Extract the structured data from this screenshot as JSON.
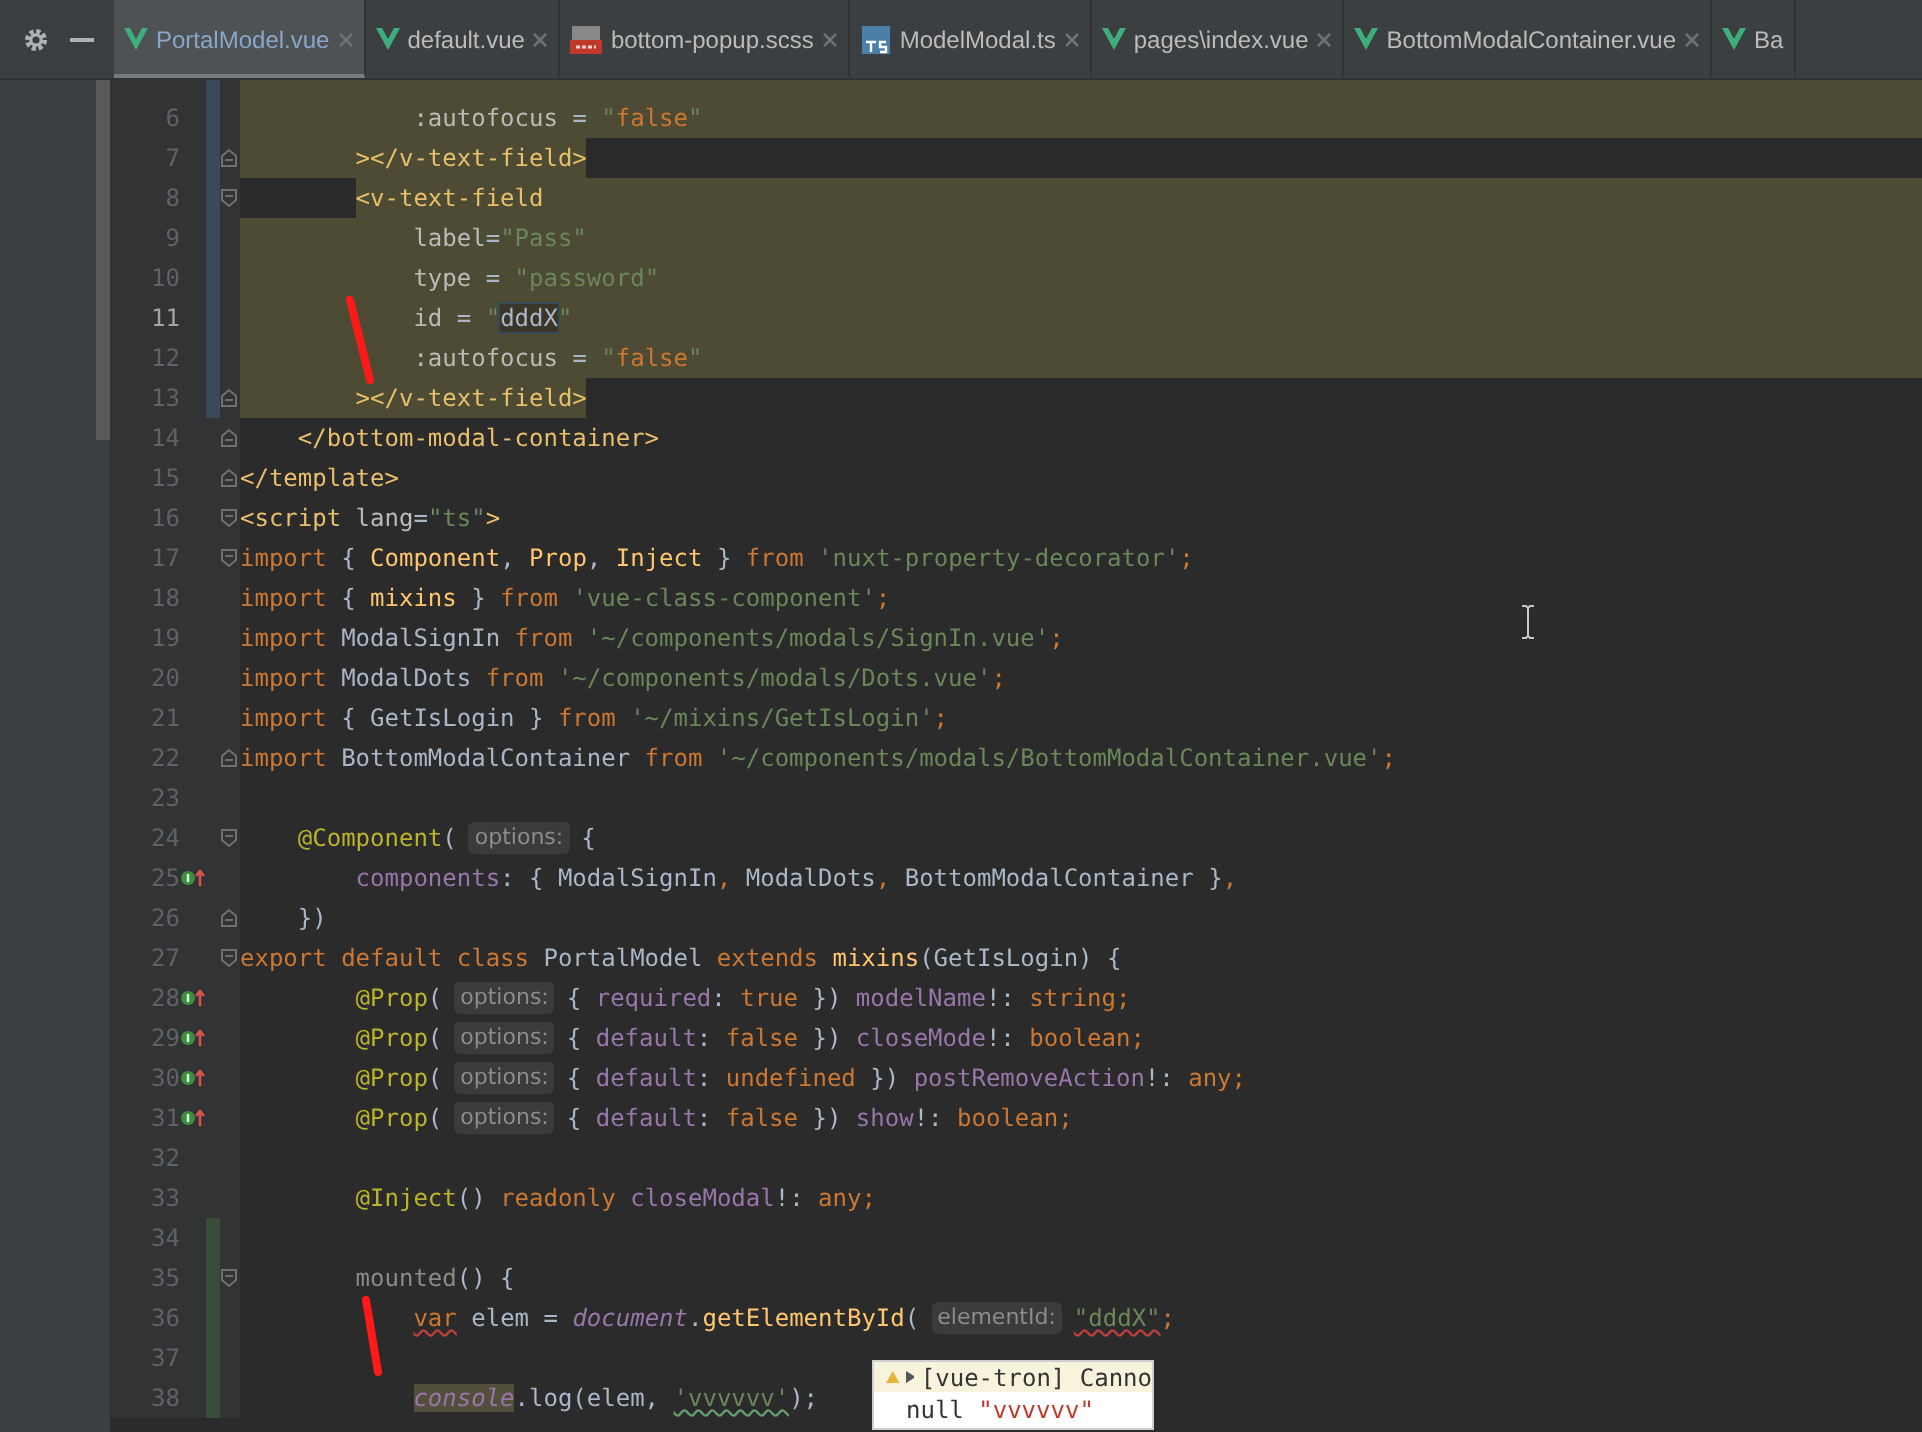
{
  "tabs": [
    {
      "label": "PortalModel.vue",
      "kind": "vue",
      "selected": true
    },
    {
      "label": "default.vue",
      "kind": "vue",
      "selected": false
    },
    {
      "label": "bottom-popup.scss",
      "kind": "sass",
      "selected": false
    },
    {
      "label": "ModelModal.ts",
      "kind": "ts",
      "selected": false
    },
    {
      "label": "pages\\index.vue",
      "kind": "vue",
      "selected": false
    },
    {
      "label": "BottomModalContainer.vue",
      "kind": "vue",
      "selected": false
    },
    {
      "label": "Ba",
      "kind": "vue",
      "selected": false
    }
  ],
  "lines": [
    {
      "number": "6",
      "current": false,
      "highlighted": true,
      "highlight_ends_at_text": false,
      "highlight_starts_at_text": false,
      "gutter_selected": true,
      "added": false,
      "fold_start": false,
      "fold_end": false,
      "overrides": false,
      "tokens": [
        {
          "kind": "attr",
          "text": "            :autofocus"
        },
        {
          "kind": "plain",
          "text": " = "
        },
        {
          "kind": "str",
          "text": "\""
        },
        {
          "kind": "kw",
          "text": "false"
        },
        {
          "kind": "str",
          "text": "\""
        }
      ]
    },
    {
      "number": "7",
      "current": false,
      "highlighted": true,
      "highlight_ends_at_text": true,
      "highlight_starts_at_text": false,
      "gutter_selected": true,
      "added": false,
      "fold_start": false,
      "fold_end": true,
      "overrides": false,
      "tokens": [
        {
          "kind": "tag",
          "text": "        ></v-text-field>"
        }
      ]
    },
    {
      "number": "8",
      "current": false,
      "highlighted": true,
      "highlight_ends_at_text": false,
      "highlight_starts_at_text": true,
      "gutter_selected": true,
      "added": false,
      "fold_start": true,
      "fold_end": false,
      "overrides": false,
      "tokens": [
        {
          "kind": "tag",
          "text": "        <v-text-field"
        }
      ]
    },
    {
      "number": "9",
      "current": false,
      "highlighted": true,
      "highlight_ends_at_text": false,
      "highlight_starts_at_text": false,
      "gutter_selected": true,
      "added": false,
      "fold_start": false,
      "fold_end": false,
      "overrides": false,
      "tokens": [
        {
          "kind": "attr",
          "text": "            label"
        },
        {
          "kind": "plain",
          "text": "="
        },
        {
          "kind": "str",
          "text": "\"Pass\""
        }
      ]
    },
    {
      "number": "10",
      "current": false,
      "highlighted": true,
      "highlight_ends_at_text": false,
      "highlight_starts_at_text": false,
      "gutter_selected": true,
      "added": false,
      "fold_start": false,
      "fold_end": false,
      "overrides": false,
      "tokens": [
        {
          "kind": "attr",
          "text": "            type"
        },
        {
          "kind": "plain",
          "text": " = "
        },
        {
          "kind": "str",
          "text": "\"password\""
        }
      ]
    },
    {
      "number": "11",
      "current": true,
      "highlighted": true,
      "highlight_ends_at_text": false,
      "highlight_starts_at_text": false,
      "gutter_selected": true,
      "added": false,
      "fold_start": false,
      "fold_end": false,
      "overrides": false,
      "tokens": [
        {
          "kind": "attr",
          "text": "            id"
        },
        {
          "kind": "plain",
          "text": " = "
        },
        {
          "kind": "str",
          "text": "\""
        },
        {
          "kind": "match",
          "text": "dddX"
        },
        {
          "kind": "str",
          "text": "\""
        }
      ]
    },
    {
      "number": "12",
      "current": false,
      "highlighted": true,
      "highlight_ends_at_text": false,
      "highlight_starts_at_text": false,
      "gutter_selected": true,
      "added": false,
      "fold_start": false,
      "fold_end": false,
      "overrides": false,
      "tokens": [
        {
          "kind": "attr",
          "text": "            :autofocus"
        },
        {
          "kind": "plain",
          "text": " = "
        },
        {
          "kind": "str",
          "text": "\""
        },
        {
          "kind": "kw",
          "text": "false"
        },
        {
          "kind": "str",
          "text": "\""
        }
      ]
    },
    {
      "number": "13",
      "current": false,
      "highlighted": true,
      "highlight_ends_at_text": true,
      "highlight_starts_at_text": false,
      "gutter_selected": true,
      "added": false,
      "fold_start": false,
      "fold_end": true,
      "overrides": false,
      "tokens": [
        {
          "kind": "tag",
          "text": "        ></v-text-field>"
        }
      ]
    },
    {
      "number": "14",
      "current": false,
      "highlighted": false,
      "gutter_selected": false,
      "added": false,
      "fold_start": false,
      "fold_end": true,
      "overrides": false,
      "tokens": [
        {
          "kind": "tag",
          "text": "    </bottom-modal-container>"
        }
      ]
    },
    {
      "number": "15",
      "current": false,
      "highlighted": false,
      "gutter_selected": false,
      "added": false,
      "fold_start": false,
      "fold_end": true,
      "overrides": false,
      "tokens": [
        {
          "kind": "tag",
          "text": "</template>"
        }
      ]
    },
    {
      "number": "16",
      "current": false,
      "highlighted": false,
      "gutter_selected": false,
      "added": false,
      "fold_start": true,
      "fold_end": false,
      "overrides": false,
      "tokens": [
        {
          "kind": "tag",
          "text": "<script "
        },
        {
          "kind": "attr",
          "text": "lang"
        },
        {
          "kind": "plain",
          "text": "="
        },
        {
          "kind": "str",
          "text": "\"ts\""
        },
        {
          "kind": "tag",
          "text": ">"
        }
      ]
    },
    {
      "number": "17",
      "current": false,
      "highlighted": false,
      "gutter_selected": false,
      "added": false,
      "fold_start": true,
      "fold_end": false,
      "overrides": false,
      "tokens": [
        {
          "kind": "kw",
          "text": "import "
        },
        {
          "kind": "plain",
          "text": "{ "
        },
        {
          "kind": "imp",
          "text": "Component"
        },
        {
          "kind": "plain",
          "text": ", "
        },
        {
          "kind": "imp",
          "text": "Prop"
        },
        {
          "kind": "plain",
          "text": ", "
        },
        {
          "kind": "imp",
          "text": "Inject"
        },
        {
          "kind": "plain",
          "text": " } "
        },
        {
          "kind": "kw",
          "text": "from "
        },
        {
          "kind": "str",
          "text": "'nuxt-property-decorator'"
        },
        {
          "kind": "kw",
          "text": ";"
        }
      ]
    },
    {
      "number": "18",
      "current": false,
      "highlighted": false,
      "gutter_selected": false,
      "added": false,
      "fold_start": false,
      "fold_end": false,
      "overrides": false,
      "tokens": [
        {
          "kind": "kw",
          "text": "import "
        },
        {
          "kind": "plain",
          "text": "{ "
        },
        {
          "kind": "imp",
          "text": "mixins"
        },
        {
          "kind": "plain",
          "text": " } "
        },
        {
          "kind": "kw",
          "text": "from "
        },
        {
          "kind": "str",
          "text": "'vue-class-component'"
        },
        {
          "kind": "kw",
          "text": ";"
        }
      ]
    },
    {
      "number": "19",
      "current": false,
      "highlighted": false,
      "gutter_selected": false,
      "added": false,
      "fold_start": false,
      "fold_end": false,
      "overrides": false,
      "tokens": [
        {
          "kind": "kw",
          "text": "import "
        },
        {
          "kind": "plain",
          "text": "ModalSignIn "
        },
        {
          "kind": "kw",
          "text": "from "
        },
        {
          "kind": "str",
          "text": "'~/components/modals/SignIn.vue'"
        },
        {
          "kind": "kw",
          "text": ";"
        }
      ]
    },
    {
      "number": "20",
      "current": false,
      "highlighted": false,
      "gutter_selected": false,
      "added": false,
      "fold_start": false,
      "fold_end": false,
      "overrides": false,
      "tokens": [
        {
          "kind": "kw",
          "text": "import "
        },
        {
          "kind": "plain",
          "text": "ModalDots "
        },
        {
          "kind": "kw",
          "text": "from "
        },
        {
          "kind": "str",
          "text": "'~/components/modals/Dots.vue'"
        },
        {
          "kind": "kw",
          "text": ";"
        }
      ]
    },
    {
      "number": "21",
      "current": false,
      "highlighted": false,
      "gutter_selected": false,
      "added": false,
      "fold_start": false,
      "fold_end": false,
      "overrides": false,
      "tokens": [
        {
          "kind": "kw",
          "text": "import "
        },
        {
          "kind": "plain",
          "text": "{ GetIsLogin } "
        },
        {
          "kind": "kw",
          "text": "from "
        },
        {
          "kind": "str",
          "text": "'~/mixins/GetIsLogin'"
        },
        {
          "kind": "kw",
          "text": ";"
        }
      ]
    },
    {
      "number": "22",
      "current": false,
      "highlighted": false,
      "gutter_selected": false,
      "added": false,
      "fold_start": false,
      "fold_end": true,
      "overrides": false,
      "tokens": [
        {
          "kind": "kw",
          "text": "import "
        },
        {
          "kind": "plain",
          "text": "BottomModalContainer "
        },
        {
          "kind": "kw",
          "text": "from "
        },
        {
          "kind": "str",
          "text": "'~/components/modals/BottomModalContainer.vue'"
        },
        {
          "kind": "kw",
          "text": ";"
        }
      ]
    },
    {
      "number": "23",
      "current": false,
      "highlighted": false,
      "gutter_selected": false,
      "added": false,
      "fold_start": false,
      "fold_end": false,
      "overrides": false
    },
    {
      "number": "24",
      "current": false,
      "highlighted": false,
      "gutter_selected": false,
      "added": false,
      "fold_start": true,
      "fold_end": false,
      "overrides": false,
      "tokens": [
        {
          "kind": "deco",
          "text": "    @Component"
        },
        {
          "kind": "plain",
          "text": "("
        },
        {
          "kind": "hint",
          "text": "options:"
        },
        {
          "kind": "plain",
          "text": "{"
        }
      ]
    },
    {
      "number": "25",
      "current": false,
      "highlighted": false,
      "gutter_selected": false,
      "added": false,
      "fold_start": false,
      "fold_end": false,
      "overrides": true,
      "tokens": [
        {
          "kind": "prop",
          "text": "        components"
        },
        {
          "kind": "plain",
          "text": ": { ModalSignIn"
        },
        {
          "kind": "kw",
          "text": ", "
        },
        {
          "kind": "plain",
          "text": "ModalDots"
        },
        {
          "kind": "kw",
          "text": ", "
        },
        {
          "kind": "plain",
          "text": "BottomModalContainer }"
        },
        {
          "kind": "kw",
          "text": ","
        }
      ]
    },
    {
      "number": "26",
      "current": false,
      "highlighted": false,
      "gutter_selected": false,
      "added": false,
      "fold_start": false,
      "fold_end": true,
      "overrides": false,
      "tokens": [
        {
          "kind": "plain",
          "text": "    })"
        }
      ]
    },
    {
      "number": "27",
      "current": false,
      "highlighted": false,
      "gutter_selected": false,
      "added": false,
      "fold_start": true,
      "fold_end": false,
      "overrides": false,
      "tokens": [
        {
          "kind": "kw",
          "text": "export default class "
        },
        {
          "kind": "plain",
          "text": "PortalModel "
        },
        {
          "kind": "kw",
          "text": "extends "
        },
        {
          "kind": "imp",
          "text": "mixins"
        },
        {
          "kind": "plain",
          "text": "(GetIsLogin) {"
        }
      ]
    },
    {
      "number": "28",
      "current": false,
      "highlighted": false,
      "gutter_selected": false,
      "added": false,
      "fold_start": false,
      "fold_end": false,
      "overrides": true,
      "tokens": [
        {
          "kind": "deco",
          "text": "        @Prop"
        },
        {
          "kind": "plain",
          "text": "("
        },
        {
          "kind": "hint",
          "text": "options:"
        },
        {
          "kind": "plain",
          "text": "{ "
        },
        {
          "kind": "prop",
          "text": "required"
        },
        {
          "kind": "plain",
          "text": ": "
        },
        {
          "kind": "kw",
          "text": "true"
        },
        {
          "kind": "plain",
          "text": " }) "
        },
        {
          "kind": "prop",
          "text": "modelName"
        },
        {
          "kind": "plain",
          "text": "!: "
        },
        {
          "kind": "kw",
          "text": "string;"
        }
      ]
    },
    {
      "number": "29",
      "current": false,
      "highlighted": false,
      "gutter_selected": false,
      "added": false,
      "fold_start": false,
      "fold_end": false,
      "overrides": true,
      "tokens": [
        {
          "kind": "deco",
          "text": "        @Prop"
        },
        {
          "kind": "plain",
          "text": "("
        },
        {
          "kind": "hint",
          "text": "options:"
        },
        {
          "kind": "plain",
          "text": "{ "
        },
        {
          "kind": "prop",
          "text": "default"
        },
        {
          "kind": "plain",
          "text": ": "
        },
        {
          "kind": "kw",
          "text": "false"
        },
        {
          "kind": "plain",
          "text": " }) "
        },
        {
          "kind": "prop",
          "text": "closeMode"
        },
        {
          "kind": "plain",
          "text": "!: "
        },
        {
          "kind": "kw",
          "text": "boolean;"
        }
      ]
    },
    {
      "number": "30",
      "current": false,
      "highlighted": false,
      "gutter_selected": false,
      "added": false,
      "fold_start": false,
      "fold_end": false,
      "overrides": true,
      "tokens": [
        {
          "kind": "deco",
          "text": "        @Prop"
        },
        {
          "kind": "plain",
          "text": "("
        },
        {
          "kind": "hint",
          "text": "options:"
        },
        {
          "kind": "plain",
          "text": "{ "
        },
        {
          "kind": "prop",
          "text": "default"
        },
        {
          "kind": "plain",
          "text": ": "
        },
        {
          "kind": "kw",
          "text": "undefined"
        },
        {
          "kind": "plain",
          "text": " }) "
        },
        {
          "kind": "prop",
          "text": "postRemoveAction"
        },
        {
          "kind": "plain",
          "text": "!: "
        },
        {
          "kind": "kw",
          "text": "any;"
        }
      ]
    },
    {
      "number": "31",
      "current": false,
      "highlighted": false,
      "gutter_selected": false,
      "added": false,
      "fold_start": false,
      "fold_end": false,
      "overrides": true,
      "tokens": [
        {
          "kind": "deco",
          "text": "        @Prop"
        },
        {
          "kind": "plain",
          "text": "("
        },
        {
          "kind": "hint",
          "text": "options:"
        },
        {
          "kind": "plain",
          "text": "{ "
        },
        {
          "kind": "prop",
          "text": "default"
        },
        {
          "kind": "plain",
          "text": ": "
        },
        {
          "kind": "kw",
          "text": "false"
        },
        {
          "kind": "plain",
          "text": " }) "
        },
        {
          "kind": "prop",
          "text": "show"
        },
        {
          "kind": "plain",
          "text": "!: "
        },
        {
          "kind": "kw",
          "text": "boolean;"
        }
      ]
    },
    {
      "number": "32",
      "current": false,
      "highlighted": false,
      "gutter_selected": false,
      "added": false,
      "fold_start": false,
      "fold_end": false,
      "overrides": false
    },
    {
      "number": "33",
      "current": false,
      "highlighted": false,
      "gutter_selected": false,
      "added": false,
      "fold_start": false,
      "fold_end": false,
      "overrides": false,
      "tokens": [
        {
          "kind": "deco",
          "text": "        @Inject"
        },
        {
          "kind": "plain",
          "text": "() "
        },
        {
          "kind": "kw",
          "text": "readonly "
        },
        {
          "kind": "prop",
          "text": "closeModal"
        },
        {
          "kind": "plain",
          "text": "!: "
        },
        {
          "kind": "kw",
          "text": "any;"
        }
      ]
    },
    {
      "number": "34",
      "current": false,
      "highlighted": false,
      "gutter_selected": false,
      "added": true,
      "fold_start": false,
      "fold_end": false,
      "overrides": false
    },
    {
      "number": "35",
      "current": false,
      "highlighted": false,
      "gutter_selected": false,
      "added": true,
      "fold_start": true,
      "fold_end": false,
      "overrides": false,
      "tokens": [
        {
          "kind": "dim",
          "text": "        mounted"
        },
        {
          "kind": "plain",
          "text": "() {"
        }
      ]
    },
    {
      "number": "36",
      "current": false,
      "highlighted": false,
      "gutter_selected": false,
      "added": true,
      "fold_start": false,
      "fold_end": false,
      "overrides": false,
      "tokens": [
        {
          "kind": "kw_err",
          "text": "            var"
        },
        {
          "kind": "plain",
          "text": " elem = "
        },
        {
          "kind": "glob",
          "text": "document"
        },
        {
          "kind": "plain",
          "text": "."
        },
        {
          "kind": "imp",
          "text": "getElementById"
        },
        {
          "kind": "plain",
          "text": "("
        },
        {
          "kind": "hint",
          "text": "elementId:"
        },
        {
          "kind": "str_err",
          "text": "\"dddX\""
        },
        {
          "kind": "kw",
          "text": ";"
        }
      ]
    },
    {
      "number": "37",
      "current": false,
      "highlighted": false,
      "gutter_selected": false,
      "added": true,
      "fold_start": false,
      "fold_end": false,
      "overrides": false
    },
    {
      "number": "38",
      "current": false,
      "highlighted": false,
      "gutter_selected": false,
      "added": true,
      "fold_start": false,
      "fold_end": false,
      "overrides": false,
      "tokens": [
        {
          "kind": "glob_hl",
          "text": "            console"
        },
        {
          "kind": "plain",
          "text": ".log(elem, "
        },
        {
          "kind": "str_typo",
          "text": "'vvvvvv'"
        },
        {
          "kind": "plain",
          "text": ");"
        }
      ]
    }
  ],
  "popup": {
    "rows": [
      {
        "kind": "warning",
        "tokens": [
          {
            "kind": "plain",
            "text": "[vue-tron] Canno"
          }
        ]
      },
      {
        "kind": "value",
        "tokens": [
          {
            "kind": "plain",
            "text": "null "
          },
          {
            "kind": "red",
            "text": "\"vvvvvv\""
          }
        ]
      }
    ]
  }
}
